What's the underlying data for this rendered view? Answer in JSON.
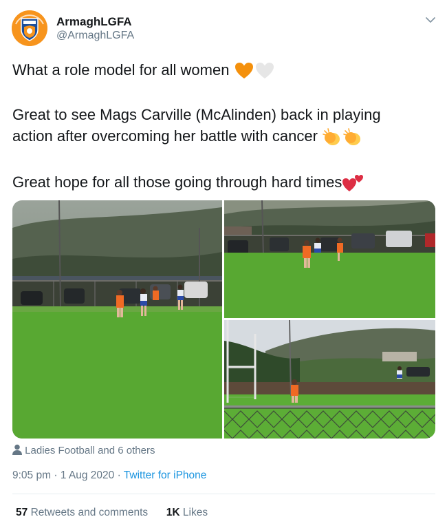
{
  "account": {
    "display_name": "ArmaghLGFA",
    "handle": "@ArmaghLGFA",
    "avatar": "armagh-lgfa-crest",
    "avatar_color": "#f7941d"
  },
  "tweet": {
    "line1": "What a role model for all women",
    "line2a": "Great to see Mags Carville (McAlinden) back in playing",
    "line2b": "action after overcoming her battle with cancer",
    "line3": "Great hope for all those going through hard times",
    "emojis": [
      "orange-heart",
      "white-heart",
      "clapping-hands",
      "clapping-hands",
      "two-hearts"
    ]
  },
  "photos": [
    {
      "name": "photo-match-wide",
      "desc": "ladies football players on pitch"
    },
    {
      "name": "photo-match-attack",
      "desc": "player in orange running"
    },
    {
      "name": "photo-match-goal",
      "desc": "player near goalposts"
    }
  ],
  "tagged": {
    "icon": "person-icon",
    "text": "Ladies Football and 6 others"
  },
  "meta": {
    "time": "9:05 pm",
    "separator": "·",
    "date": "1 Aug 2020",
    "source": "Twitter for iPhone"
  },
  "stats": {
    "retweets_count": "57",
    "retweets_label": "Retweets and comments",
    "likes_count": "1K",
    "likes_label": "Likes"
  },
  "colors": {
    "accent": "#1b95e0",
    "muted": "#657786",
    "armagh_orange": "#f7941d"
  }
}
